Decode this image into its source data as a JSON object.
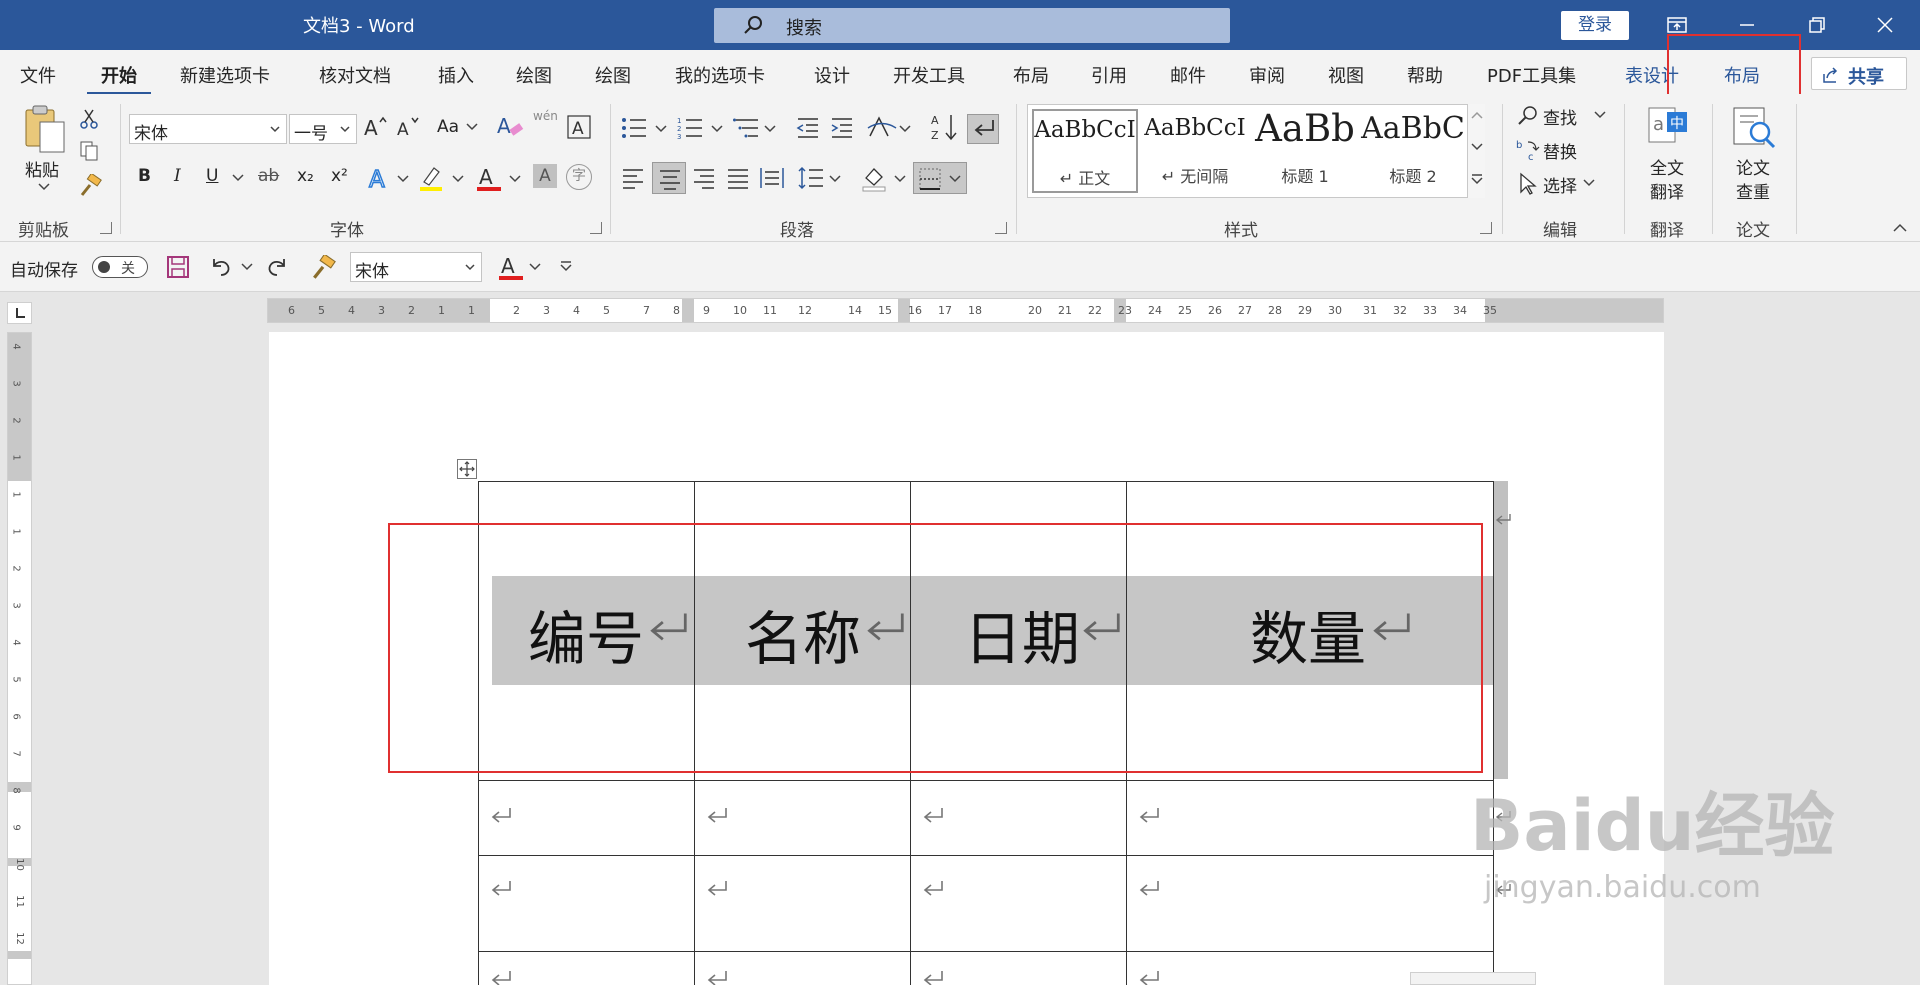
{
  "titlebar": {
    "doc_title": "文档3  -  Word",
    "search_placeholder": "搜索",
    "login_label": "登录"
  },
  "tabs": [
    {
      "label": "文件"
    },
    {
      "label": "开始"
    },
    {
      "label": "新建选项卡"
    },
    {
      "label": "核对文档"
    },
    {
      "label": "插入"
    },
    {
      "label": "绘图"
    },
    {
      "label": "绘图"
    },
    {
      "label": "我的选项卡"
    },
    {
      "label": "设计"
    },
    {
      "label": "开发工具"
    },
    {
      "label": "布局"
    },
    {
      "label": "引用"
    },
    {
      "label": "邮件"
    },
    {
      "label": "审阅"
    },
    {
      "label": "视图"
    },
    {
      "label": "帮助"
    },
    {
      "label": "PDF工具集"
    },
    {
      "label": "表设计"
    },
    {
      "label": "布局"
    }
  ],
  "share_label": "共享",
  "ribbon": {
    "clipboard": {
      "paste_label": "粘贴",
      "group_label": "剪贴板"
    },
    "font": {
      "font_name": "宋体",
      "font_size": "一号",
      "case_label": "Aa",
      "phonetic_label": "wén",
      "group_label": "字体",
      "bold": "B",
      "italic": "I",
      "underline": "U",
      "strike": "ab",
      "subscript": "x₂",
      "superscript": "x²",
      "char_shade": "A",
      "enclose": "字"
    },
    "paragraph": {
      "group_label": "段落"
    },
    "styles": {
      "group_label": "样式",
      "items": [
        {
          "sample": "AaBbCcI",
          "name": "↵ 正文"
        },
        {
          "sample": "AaBbCcI",
          "name": "↵ 无间隔"
        },
        {
          "sample": "AaBb",
          "name": "标题 1"
        },
        {
          "sample": "AaBbC",
          "name": "标题 2"
        }
      ]
    },
    "editing": {
      "find": "查找",
      "replace": "替换",
      "select": "选择",
      "group_label": "编辑"
    },
    "translate": {
      "btn_label_1": "全文",
      "btn_label_2": "翻译",
      "group_label": "翻译"
    },
    "paper": {
      "btn_label_1": "论文",
      "btn_label_2": "查重",
      "group_label": "论文"
    }
  },
  "qat": {
    "autosave_label": "自动保存",
    "toggle_state": "关",
    "font_name": "宋体"
  },
  "ruler": {
    "h_numbers": [
      "6",
      "5",
      "4",
      "3",
      "2",
      "1",
      "1",
      "2",
      "3",
      "4",
      "5",
      "7",
      "8",
      "9",
      "10",
      "11",
      "12",
      "14",
      "15",
      "16",
      "17",
      "18",
      "20",
      "21",
      "22",
      "23",
      "24",
      "25",
      "26",
      "27",
      "28",
      "29",
      "30",
      "31",
      "32",
      "33",
      "34",
      "35"
    ],
    "v_numbers": [
      "4",
      "3",
      "2",
      "1",
      "1",
      "1",
      "2",
      "3",
      "4",
      "5",
      "6",
      "7",
      "8",
      "9",
      "10",
      "11",
      "12"
    ]
  },
  "table": {
    "headers": [
      "编号",
      "名称",
      "日期",
      "数量"
    ]
  },
  "watermark": {
    "line1": "Baidu经验",
    "line2": "jingyan.baidu.com"
  },
  "colors": {
    "brand": "#2b579a",
    "highlight_red": "#e03030",
    "header_shade": "#c6c6c6"
  }
}
